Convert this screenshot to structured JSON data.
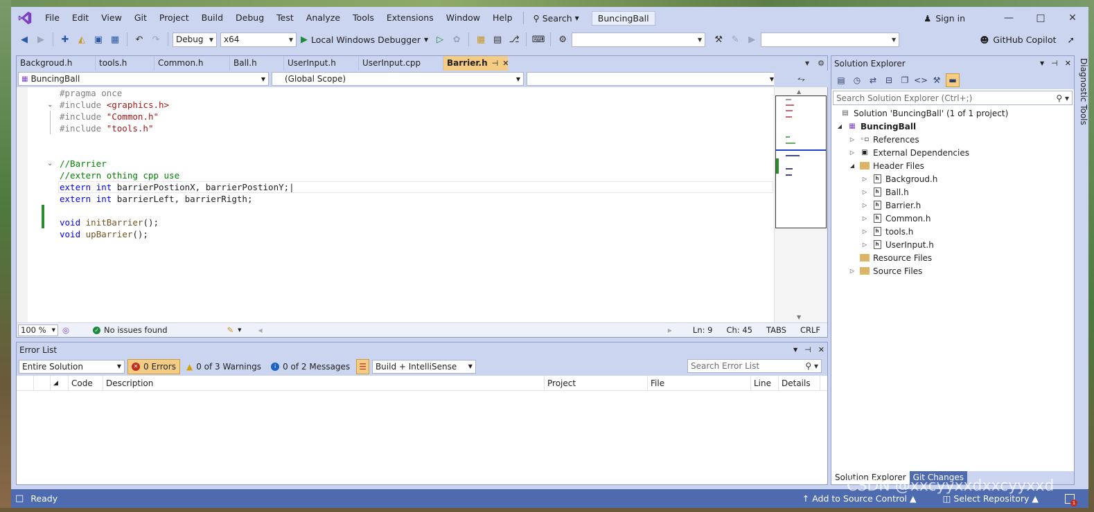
{
  "menubar": {
    "items": [
      "File",
      "Edit",
      "View",
      "Git",
      "Project",
      "Build",
      "Debug",
      "Test",
      "Analyze",
      "Tools",
      "Extensions",
      "Window",
      "Help"
    ],
    "search_label": "Search",
    "solution_name": "BuncingBall",
    "signin_label": "Sign in"
  },
  "toolbar": {
    "configuration": "Debug",
    "platform": "x64",
    "run_label": "Local Windows Debugger",
    "copilot_label": "GitHub Copilot"
  },
  "tabs": [
    "Backgroud.h",
    "tools.h",
    "Common.h",
    "Ball.h",
    "UserInput.h",
    "UserInput.cpp",
    "Barrier.h"
  ],
  "active_tab": "Barrier.h",
  "navbar": {
    "project": "BuncingBall",
    "scope": "(Global Scope)",
    "member": ""
  },
  "code": {
    "l1": "#pragma once",
    "l2_pp": "#include ",
    "l2_inc": "<graphics.h>",
    "l3_pp": "#include ",
    "l3_inc": "\"Common.h\"",
    "l4_pp": "#include ",
    "l4_inc": "\"tools.h\"",
    "l7": "//Barrier",
    "l8": "//extern othing cpp use",
    "l9_kw1": "extern",
    "l9_kw2": "int",
    "l9_rest": "barrierPostionX, barrierPostionY;",
    "l10_kw1": "extern",
    "l10_kw2": "int",
    "l10_rest": "barrierLeft, barrierRigth;",
    "l12_kw": "void",
    "l12_fn": "initBarrier",
    "l12_rest": "();",
    "l13_kw": "void",
    "l13_fn": "upBarrier",
    "l13_rest": "();"
  },
  "editor_status": {
    "zoom": "100 %",
    "issues": "No issues found",
    "line": "Ln: 9",
    "col": "Ch: 45",
    "indent": "TABS",
    "eol": "CRLF"
  },
  "error_list": {
    "title": "Error List",
    "scope": "Entire Solution",
    "errors": "0 Errors",
    "warnings": "0 of 3 Warnings",
    "messages": "0 of 2 Messages",
    "source": "Build + IntelliSense",
    "search_placeholder": "Search Error List",
    "columns": [
      "Code",
      "Description",
      "Project",
      "File",
      "Line",
      "Details"
    ]
  },
  "solution_explorer": {
    "title": "Solution Explorer",
    "search_placeholder": "Search Solution Explorer (Ctrl+;)",
    "solution": "Solution 'BuncingBall' (1 of 1 project)",
    "project": "BuncingBall",
    "references": "References",
    "external_deps": "External Dependencies",
    "header_files": "Header Files",
    "headers": [
      "Backgroud.h",
      "Ball.h",
      "Barrier.h",
      "Common.h",
      "tools.h",
      "UserInput.h"
    ],
    "resource_files": "Resource Files",
    "source_files": "Source Files",
    "bottom_tabs": [
      "Solution Explorer",
      "Git Changes"
    ]
  },
  "diagnostic_tools": "Diagnostic Tools",
  "statusbar": {
    "ready": "Ready",
    "source_control": "Add to Source Control",
    "repository": "Select Repository",
    "notifications": "1"
  },
  "watermark": "CSDN @xxcyyxxdxxcyyxxd",
  "colors": {
    "accent": "#4e6bb0",
    "chrome": "#ccd5f0",
    "active_tab": "#f5cc84",
    "keyword": "#0000ff",
    "string": "#a31515",
    "comment": "#008000"
  }
}
